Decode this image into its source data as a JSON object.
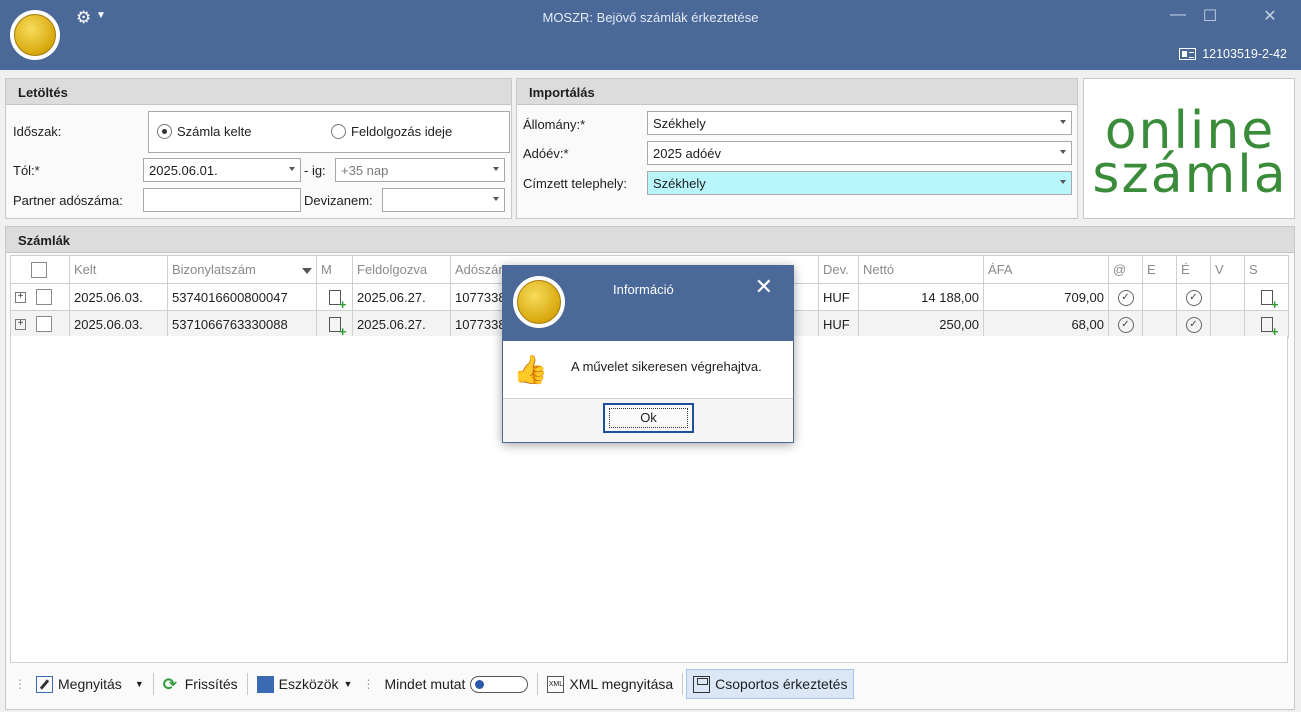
{
  "window": {
    "title": "MOSZR: Bejövő számlák érkeztetése",
    "user_id": "12103519-2-42",
    "minimize": "—",
    "maximize": "☐",
    "close": "✕"
  },
  "download_panel": {
    "title": "Letöltés",
    "period_label": "Időszak:",
    "radio_invoice_date": "Számla kelte",
    "radio_processing_date": "Feldolgozás ideje",
    "selected_radio": "Számla kelte",
    "from_label": "Tól:*",
    "from_value": "2025.06.01.",
    "to_label": "- ig:",
    "to_value": "+35 nap",
    "partner_tax_label": "Partner adószáma:",
    "partner_tax_value": "",
    "currency_label": "Devizanem:",
    "currency_value": ""
  },
  "import_panel": {
    "title": "Importálás",
    "file_label": "Állomány:*",
    "file_value": "Székhely",
    "year_label": "Adóév:*",
    "year_value": "2025 adóév",
    "site_label": "Címzett telephely:",
    "site_value": "Székhely"
  },
  "brand": {
    "line1": "online",
    "line2": "számla",
    "color": "#3a8c3a"
  },
  "invoices_panel": {
    "title": "Számlák",
    "columns": [
      "Kelt",
      "Bizonylatszám",
      "M",
      "Feldolgozva",
      "Adószám",
      "Dev.",
      "Nettó",
      "ÁFA",
      "@",
      "E",
      "É",
      "V",
      "S"
    ],
    "rows": [
      {
        "kelt": "2025.06.03.",
        "bizonylatszam": "5374016600800047",
        "feldolgozva": "2025.06.27.",
        "adoszam": "1077338",
        "dev": "HUF",
        "netto": "14 188,00",
        "afa": "709,00"
      },
      {
        "kelt": "2025.06.03.",
        "bizonylatszam": "5371066763330088",
        "feldolgozva": "2025.06.27.",
        "adoszam": "1077338",
        "dev": "HUF",
        "netto": "250,00",
        "afa": "68,00"
      }
    ]
  },
  "toolbar": {
    "open": "Megnyitás",
    "refresh": "Frissítés",
    "tools": "Eszközök",
    "show_all": "Mindet mutat",
    "xml_open": "XML megnyitása",
    "group_register": "Csoportos érkeztetés"
  },
  "dialog": {
    "title": "Információ",
    "message": "A művelet sikeresen végrehajtva.",
    "ok": "Ok"
  }
}
